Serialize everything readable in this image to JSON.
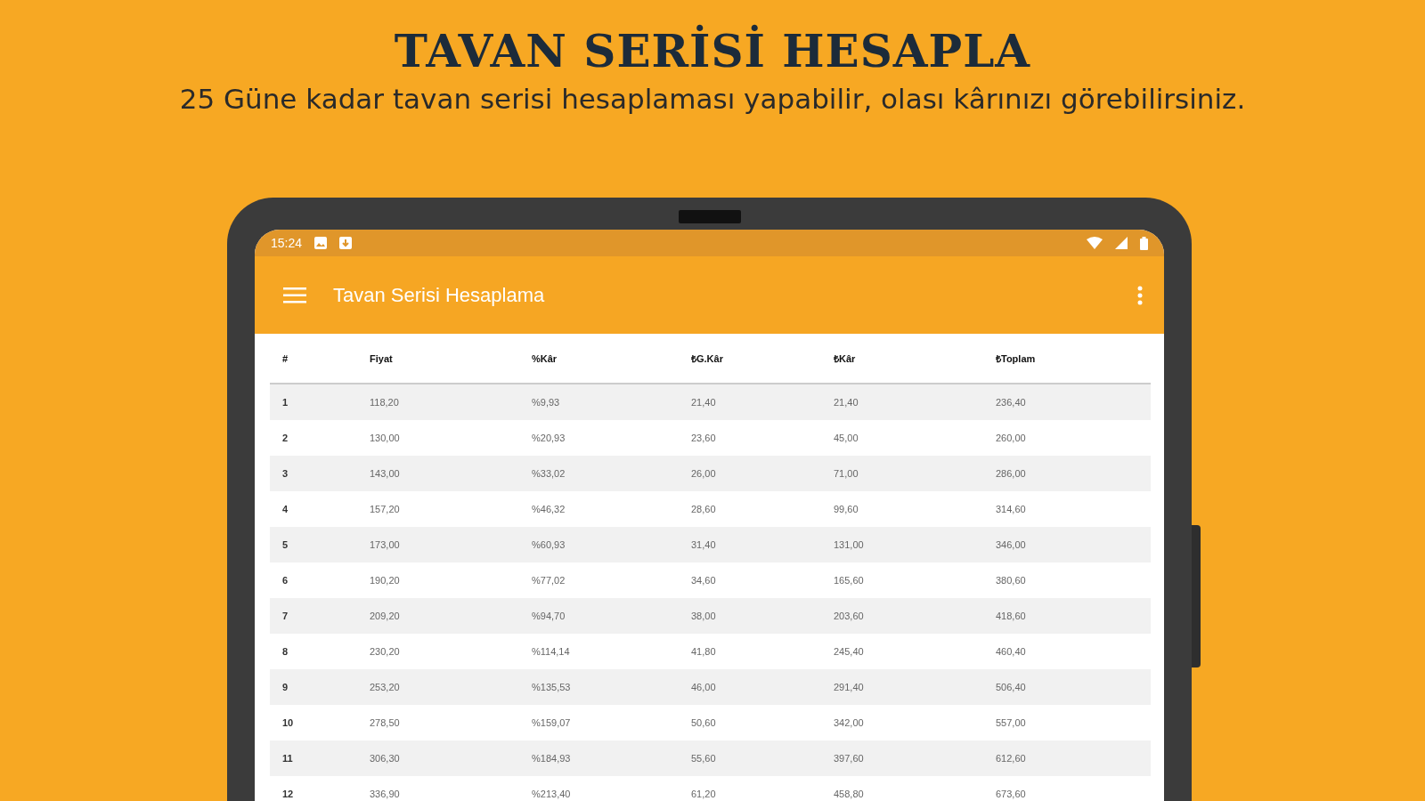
{
  "headline": {
    "title": "TAVAN SERİSİ HESAPLA",
    "subtitle": "25 Güne kadar tavan serisi hesaplaması yapabilir, olası kârınızı görebilirsiniz."
  },
  "status_bar": {
    "time": "15:24"
  },
  "app_bar": {
    "title": "Tavan Serisi Hesaplama"
  },
  "table": {
    "columns": [
      "#",
      "Fiyat",
      "%Kâr",
      "₺G.Kâr",
      "₺Kâr",
      "₺Toplam"
    ],
    "rows": [
      [
        "1",
        "118,20",
        "%9,93",
        "21,40",
        "21,40",
        "236,40"
      ],
      [
        "2",
        "130,00",
        "%20,93",
        "23,60",
        "45,00",
        "260,00"
      ],
      [
        "3",
        "143,00",
        "%33,02",
        "26,00",
        "71,00",
        "286,00"
      ],
      [
        "4",
        "157,20",
        "%46,32",
        "28,60",
        "99,60",
        "314,60"
      ],
      [
        "5",
        "173,00",
        "%60,93",
        "31,40",
        "131,00",
        "346,00"
      ],
      [
        "6",
        "190,20",
        "%77,02",
        "34,60",
        "165,60",
        "380,60"
      ],
      [
        "7",
        "209,20",
        "%94,70",
        "38,00",
        "203,60",
        "418,60"
      ],
      [
        "8",
        "230,20",
        "%114,14",
        "41,80",
        "245,40",
        "460,40"
      ],
      [
        "9",
        "253,20",
        "%135,53",
        "46,00",
        "291,40",
        "506,40"
      ],
      [
        "10",
        "278,50",
        "%159,07",
        "50,60",
        "342,00",
        "557,00"
      ],
      [
        "11",
        "306,30",
        "%184,93",
        "55,60",
        "397,60",
        "612,60"
      ],
      [
        "12",
        "336,90",
        "%213,40",
        "61,20",
        "458,80",
        "673,60"
      ]
    ]
  }
}
